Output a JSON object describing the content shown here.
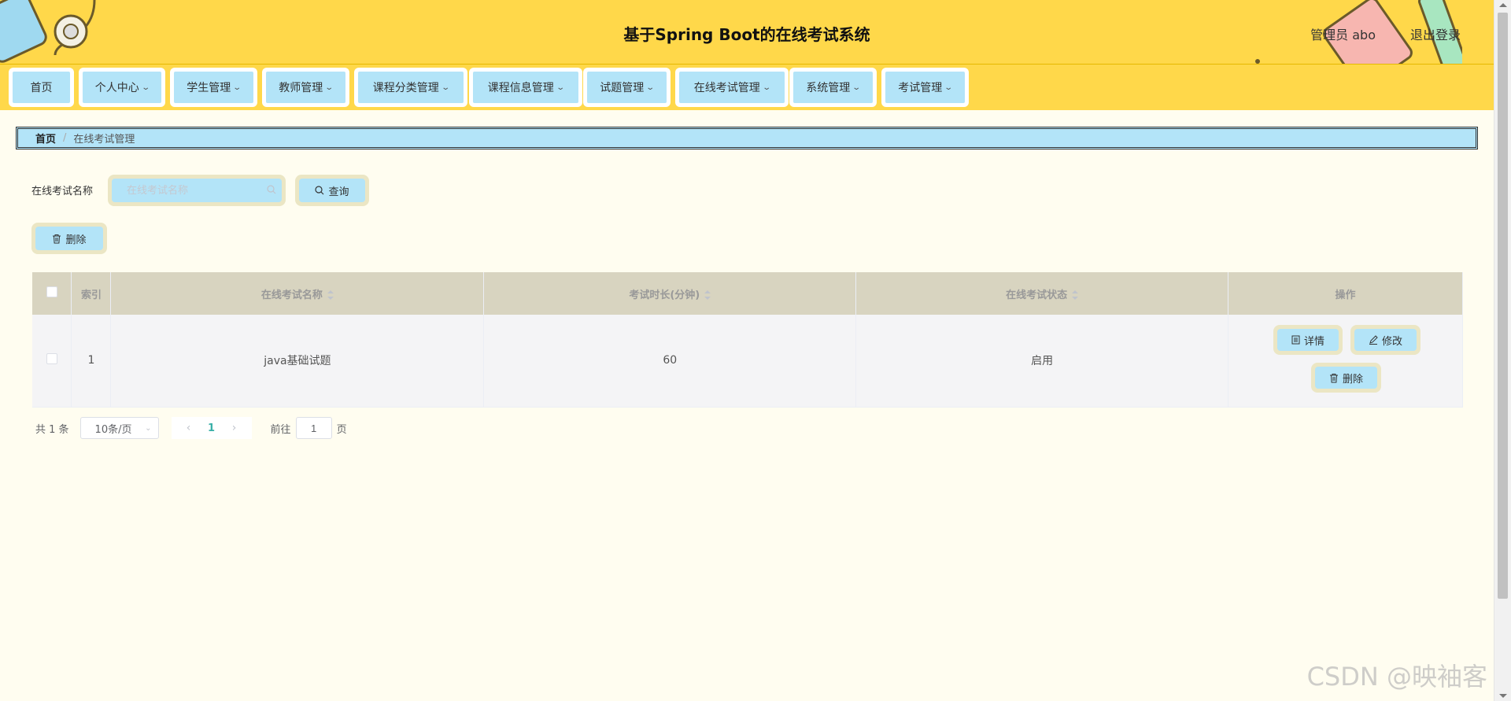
{
  "header": {
    "title": "基于Spring Boot的在线考试系统",
    "user": "管理员 abo",
    "logout": "退出登录",
    "background_color": "#ffd84a"
  },
  "nav": {
    "items": [
      {
        "label": "首页",
        "has_dropdown": false
      },
      {
        "label": "个人中心",
        "has_dropdown": true
      },
      {
        "label": "学生管理",
        "has_dropdown": true
      },
      {
        "label": "教师管理",
        "has_dropdown": true
      },
      {
        "label": "课程分类管理",
        "has_dropdown": true
      },
      {
        "label": "课程信息管理",
        "has_dropdown": true
      },
      {
        "label": "试题管理",
        "has_dropdown": true
      },
      {
        "label": "在线考试管理",
        "has_dropdown": true
      },
      {
        "label": "系统管理",
        "has_dropdown": true
      },
      {
        "label": "考试管理",
        "has_dropdown": true
      }
    ]
  },
  "breadcrumb": {
    "home": "首页",
    "separator": "/",
    "current": "在线考试管理"
  },
  "search": {
    "label": "在线考试名称",
    "value": "",
    "placeholder": "在线考试名称",
    "query_button": "查询"
  },
  "toolbar": {
    "delete_button": "删除"
  },
  "table": {
    "columns": [
      {
        "label": "",
        "type": "checkbox"
      },
      {
        "label": "索引",
        "sortable": false
      },
      {
        "label": "在线考试名称",
        "sortable": true
      },
      {
        "label": "考试时长(分钟)",
        "sortable": true
      },
      {
        "label": "在线考试状态",
        "sortable": true
      },
      {
        "label": "操作",
        "sortable": false
      }
    ],
    "rows": [
      {
        "index": "1",
        "name": "java基础试题",
        "duration": "60",
        "status": "启用",
        "actions": {
          "detail": "详情",
          "edit": "修改",
          "delete": "删除"
        }
      }
    ]
  },
  "pagination": {
    "total": "共 1 条",
    "page_size": "10条/页",
    "current_page": "1",
    "goto_prefix": "前往",
    "goto_value": "1",
    "goto_suffix": "页"
  },
  "watermark": "CSDN @映袖客",
  "colors": {
    "accent_blue": "#b3e4f8",
    "button_border": "#ebe6c4",
    "table_header": "#d8d4c0",
    "page_background": "#fffdf0"
  }
}
